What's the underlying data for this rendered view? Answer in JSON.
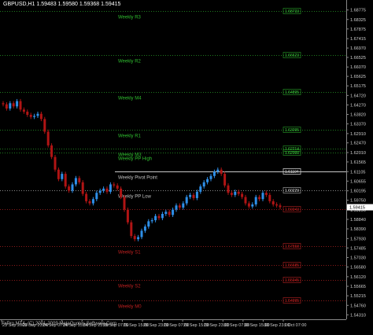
{
  "header": {
    "text": "GBPUSD,H1  1.59483 1.59580 1.59368 1.59415"
  },
  "footer": {
    "text": "FxPro MT4, (C) 2001-2009 MetaQuotes Software Corp."
  },
  "price_axis": {
    "ticks": [
      "1.68775",
      "1.68325",
      "1.67875",
      "1.67415",
      "1.66970",
      "1.66525",
      "1.66070",
      "1.65625",
      "1.65175",
      "1.64720",
      "1.64270",
      "1.63820",
      "1.63370",
      "1.62910",
      "1.62470",
      "1.62010",
      "1.61565",
      "1.61105",
      "1.60655",
      "1.60195",
      "1.59750",
      "1.59290",
      "1.58840",
      "1.58390",
      "1.57930",
      "1.57485",
      "1.57030",
      "1.56580",
      "1.56120",
      "1.55665",
      "1.55215",
      "1.54760",
      "1.54310"
    ],
    "current_price": "1.59415"
  },
  "time_axis": {
    "labels": [
      "23 Sep 2009",
      "23 Sep 23:00",
      "24 Sep 07:00",
      "24 Sep 15:00",
      "24 Sep 23:00",
      "25 Sep 07:00",
      "25 Sep 15:00",
      "28 Sep 23:00",
      "29 Sep 07:00",
      "29 Sep 15:00",
      "29 Sep 23:00",
      "30 Sep 07:00",
      "30 Sep 15:00",
      "30 Sep 23:00",
      "1 Oct 07:00"
    ]
  },
  "levels": [
    {
      "label": "Weekly R3",
      "price_label": "1.68733",
      "price": 1.6874,
      "color": "#1f7a1f"
    },
    {
      "label": "Weekly R2",
      "price_label": "1.66623",
      "price": 1.6662,
      "color": "#1f7a1f"
    },
    {
      "label": "Weekly M4",
      "price_label": "1.64895",
      "price": 1.649,
      "color": "#1f7a1f"
    },
    {
      "label": "Weekly R1",
      "price_label": "1.63095",
      "price": 1.631,
      "color": "#1f7a1f"
    },
    {
      "label": "Weekly M3",
      "price_label": "1.62214",
      "price": 1.622,
      "color": "#1f7a1f"
    },
    {
      "label": "Weekly PP High",
      "price_label": "1.62000",
      "price": 1.62,
      "color": "#1f7a1f"
    },
    {
      "label": "Weekly Pivot Point",
      "price_label": "1.61104",
      "price": 1.611,
      "color": "#c8c8c8"
    },
    {
      "label": "Weekly PP Low",
      "price_label": "1.60229",
      "price": 1.6023,
      "color": "#8a8a8a"
    },
    {
      "label": "",
      "price_label": "1.59343",
      "price": 1.5934,
      "color": "#8a1a1a"
    },
    {
      "label": "Weekly S1",
      "price_label": "1.57558",
      "price": 1.5756,
      "color": "#8a1a1a"
    },
    {
      "label": "",
      "price_label": "1.56685",
      "price": 1.5669,
      "color": "#8a1a1a"
    },
    {
      "label": "Weekly S2",
      "price_label": "1.55945",
      "price": 1.5595,
      "color": "#8a1a1a"
    },
    {
      "label": "Weekly M0",
      "price_label": "1.54995",
      "price": 1.55,
      "color": "#8a1a1a"
    }
  ],
  "colors": {
    "background": "#000000",
    "bull_bar": "#2e8fe8",
    "bear_bar": "#b01414",
    "axis_text": "#d0d0d0",
    "header_text": "#ffffff",
    "green_label": "#2fbf2f",
    "white_line": "#ffffff"
  },
  "chart_data": {
    "type": "candlestick",
    "symbol": "GBPUSD",
    "timeframe": "H1",
    "last": {
      "open": 1.59483,
      "high": 1.5958,
      "low": 1.59368,
      "close": 1.59415
    },
    "close_path": [
      1.643,
      1.641,
      1.6435,
      1.642,
      1.6445,
      1.6405,
      1.6395,
      1.638,
      1.637,
      1.6375,
      1.6385,
      1.636,
      1.63,
      1.6235,
      1.618,
      1.612,
      1.6075,
      1.61,
      1.604,
      1.602,
      1.605,
      1.608,
      1.606,
      1.6005,
      1.597,
      1.596,
      1.598,
      1.601,
      1.602,
      1.603,
      1.6015,
      1.605,
      1.6045,
      1.603,
      1.599,
      1.593,
      1.587,
      1.5805,
      1.579,
      1.58,
      1.583,
      1.585,
      1.5875,
      1.588,
      1.59,
      1.589,
      1.591,
      1.592,
      1.5905,
      1.593,
      1.595,
      1.594,
      1.596,
      1.599,
      1.6,
      1.5985,
      1.6015,
      1.604,
      1.606,
      1.6075,
      1.609,
      1.611,
      1.612,
      1.61,
      1.6045,
      1.601,
      1.6,
      1.6015,
      1.6005,
      1.599,
      1.596,
      1.5945,
      1.5955,
      1.599,
      1.598,
      1.601,
      1.6,
      1.597,
      1.5955,
      1.595,
      1.5942
    ],
    "ylim": [
      1.541,
      1.6895
    ]
  }
}
